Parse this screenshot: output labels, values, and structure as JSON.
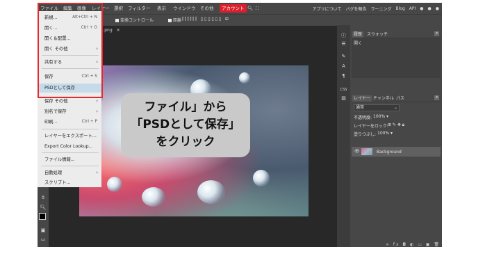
{
  "menubar": {
    "items": [
      "ファイル",
      "編集",
      "画像",
      "レイヤー",
      "選択",
      "フィルター",
      "表示",
      "ウインドウ",
      "その他"
    ],
    "account": "アカウント",
    "right": [
      "アプリについて",
      "バグを報告",
      "ラーニング",
      "Blog",
      "API"
    ]
  },
  "options": {
    "transform": "変換コントロール",
    "distance": "距離"
  },
  "document": {
    "tab": ").png"
  },
  "dropdown": {
    "new": "新規...",
    "new_sc": "Alt+Ctrl + N",
    "open": "開く...",
    "open_sc": "Ctrl + O",
    "open_place": "開く＆配置...",
    "open_more": "開く その他",
    "share": "共有する",
    "save": "保存",
    "save_sc": "Ctrl + S",
    "save_psd": "PSDとして保存",
    "save_more": "保存 その他",
    "save_as": "別名で保存",
    "print": "印刷...",
    "print_sc": "Ctrl + P",
    "export_layers": "レイヤーをエクスポート...",
    "export_color": "Export Color Lookup...",
    "file_info": "ファイル情報...",
    "automate": "自動処理",
    "script": "スクリプト..."
  },
  "callout": {
    "line1": "ファイル」から",
    "line2": "「PSDとして保存」",
    "line3": "をクリック"
  },
  "panels": {
    "history_tab": "履歴",
    "swatch_tab": "スウォッチ",
    "history_item": "開く",
    "layers_tab": "レイヤー",
    "channels_tab": "チャンネル",
    "paths_tab": "パス",
    "blend_mode": "通常",
    "opacity_label": "不透明度:",
    "opacity_value": "100%",
    "lock_label": "レイヤーをロック:",
    "fill_label": "塗りつぶし:",
    "fill_value": "100%",
    "layer_name": "Background",
    "css_label": "CSS"
  },
  "colors": {
    "accent_red": "#e8282b",
    "account_bg": "#d9202c",
    "highlight": "#c6dbe9"
  }
}
